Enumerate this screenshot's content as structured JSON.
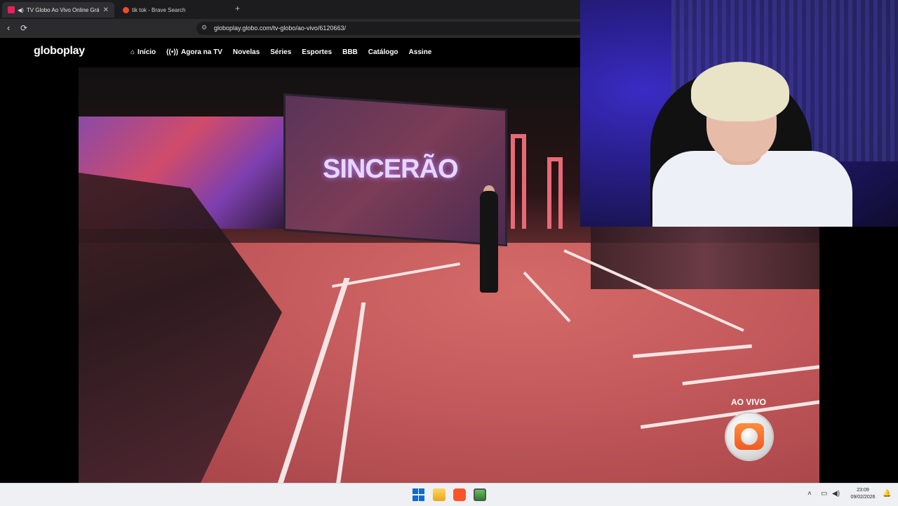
{
  "browser": {
    "tabs": [
      {
        "title": "TV Globo Ao Vivo Online Grá",
        "active": true
      },
      {
        "title": "tik tok - Brave Search",
        "active": false
      }
    ],
    "new_tab_symbol": "+",
    "url": "globoplay.globo.com/tv-globo/ao-vivo/6120663/"
  },
  "globoplay": {
    "logo": "globoplay",
    "menu": [
      "Início",
      "Agora na TV",
      "Novelas",
      "Séries",
      "Esportes",
      "BBB",
      "Catálogo",
      "Assine"
    ]
  },
  "video": {
    "show_sign": "SINCERÃO",
    "live_label": "AO VIVO"
  },
  "taskbar": {
    "time": "23:09",
    "date": "09/02/2026"
  },
  "colors": {
    "accent_globo": "#e8205a",
    "brave": "#fb542b",
    "windows_blue": "#0a6cd6"
  }
}
